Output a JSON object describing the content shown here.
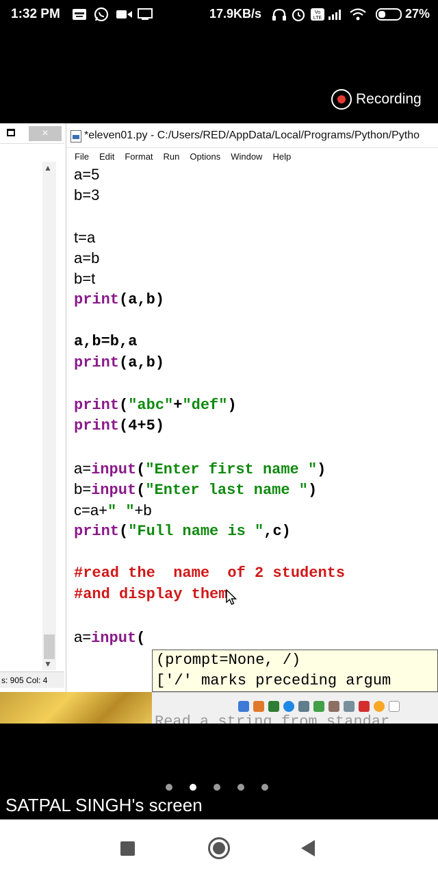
{
  "status_bar": {
    "time": "1:32 PM",
    "net_speed": "17.9KB/s",
    "battery": "27%",
    "icons": [
      "paytm-icon",
      "whatsapp-icon",
      "video-icon",
      "tv-icon",
      "headphones-icon",
      "alarm-icon",
      "volte-icon",
      "signal-icon",
      "wifi-icon",
      "battery-icon"
    ]
  },
  "recording": {
    "label": "Recording",
    "dot_color": "#e53935"
  },
  "shell_window": {
    "close_label": "×",
    "status": "s: 905   Col: 4"
  },
  "editor": {
    "title": "*eleven01.py - C:/Users/RED/AppData/Local/Programs/Python/Pytho",
    "menu": [
      "File",
      "Edit",
      "Format",
      "Run",
      "Options",
      "Window",
      "Help"
    ],
    "code_colors": {
      "keyword": "#8a1a8a",
      "string": "#108a10",
      "comment": "#d11818"
    },
    "lines": {
      "l1": "a=5",
      "l2": "b=3",
      "l3": "t=a",
      "l4": "a=b",
      "l5": "b=t",
      "l6_kw": "print",
      "l6_rest": "(a,b)",
      "l7": "a,b=b,a",
      "l8_kw": "print",
      "l8_rest": "(a,b)",
      "l9_kw": "print",
      "l9_p1": "(",
      "l9_s1": "\"abc\"",
      "l9_p2": "+",
      "l9_s2": "\"def\"",
      "l9_p3": ")",
      "l10_kw": "print",
      "l10_rest": "(4+5)",
      "l11_a": "a=",
      "l11_kw": "input",
      "l11_p1": "(",
      "l11_s": "\"Enter first name \"",
      "l11_p2": ")",
      "l12_a": "b=",
      "l12_kw": "input",
      "l12_p1": "(",
      "l12_s": "\"Enter last name \"",
      "l12_p2": ")",
      "l13_a": "c=a+",
      "l13_s": "\" \"",
      "l13_b": "+b",
      "l14_kw": "print",
      "l14_p1": "(",
      "l14_s": "\"Full name is \"",
      "l14_p2": ",c)",
      "l15": "#read the  name  of 2 students",
      "l16": "#and display them",
      "l17_a": "a=",
      "l17_kw": "input",
      "l17_p": "("
    },
    "calltip": {
      "line1": "(prompt=None, /)",
      "line2": "['/' marks preceding argum",
      "line3_faded": "Read a string from standar"
    }
  },
  "pager": {
    "count": 5,
    "active": 1
  },
  "screen_owner": "SATPAL SINGH's screen",
  "navbar": {
    "buttons": [
      "recents",
      "home",
      "back"
    ]
  }
}
